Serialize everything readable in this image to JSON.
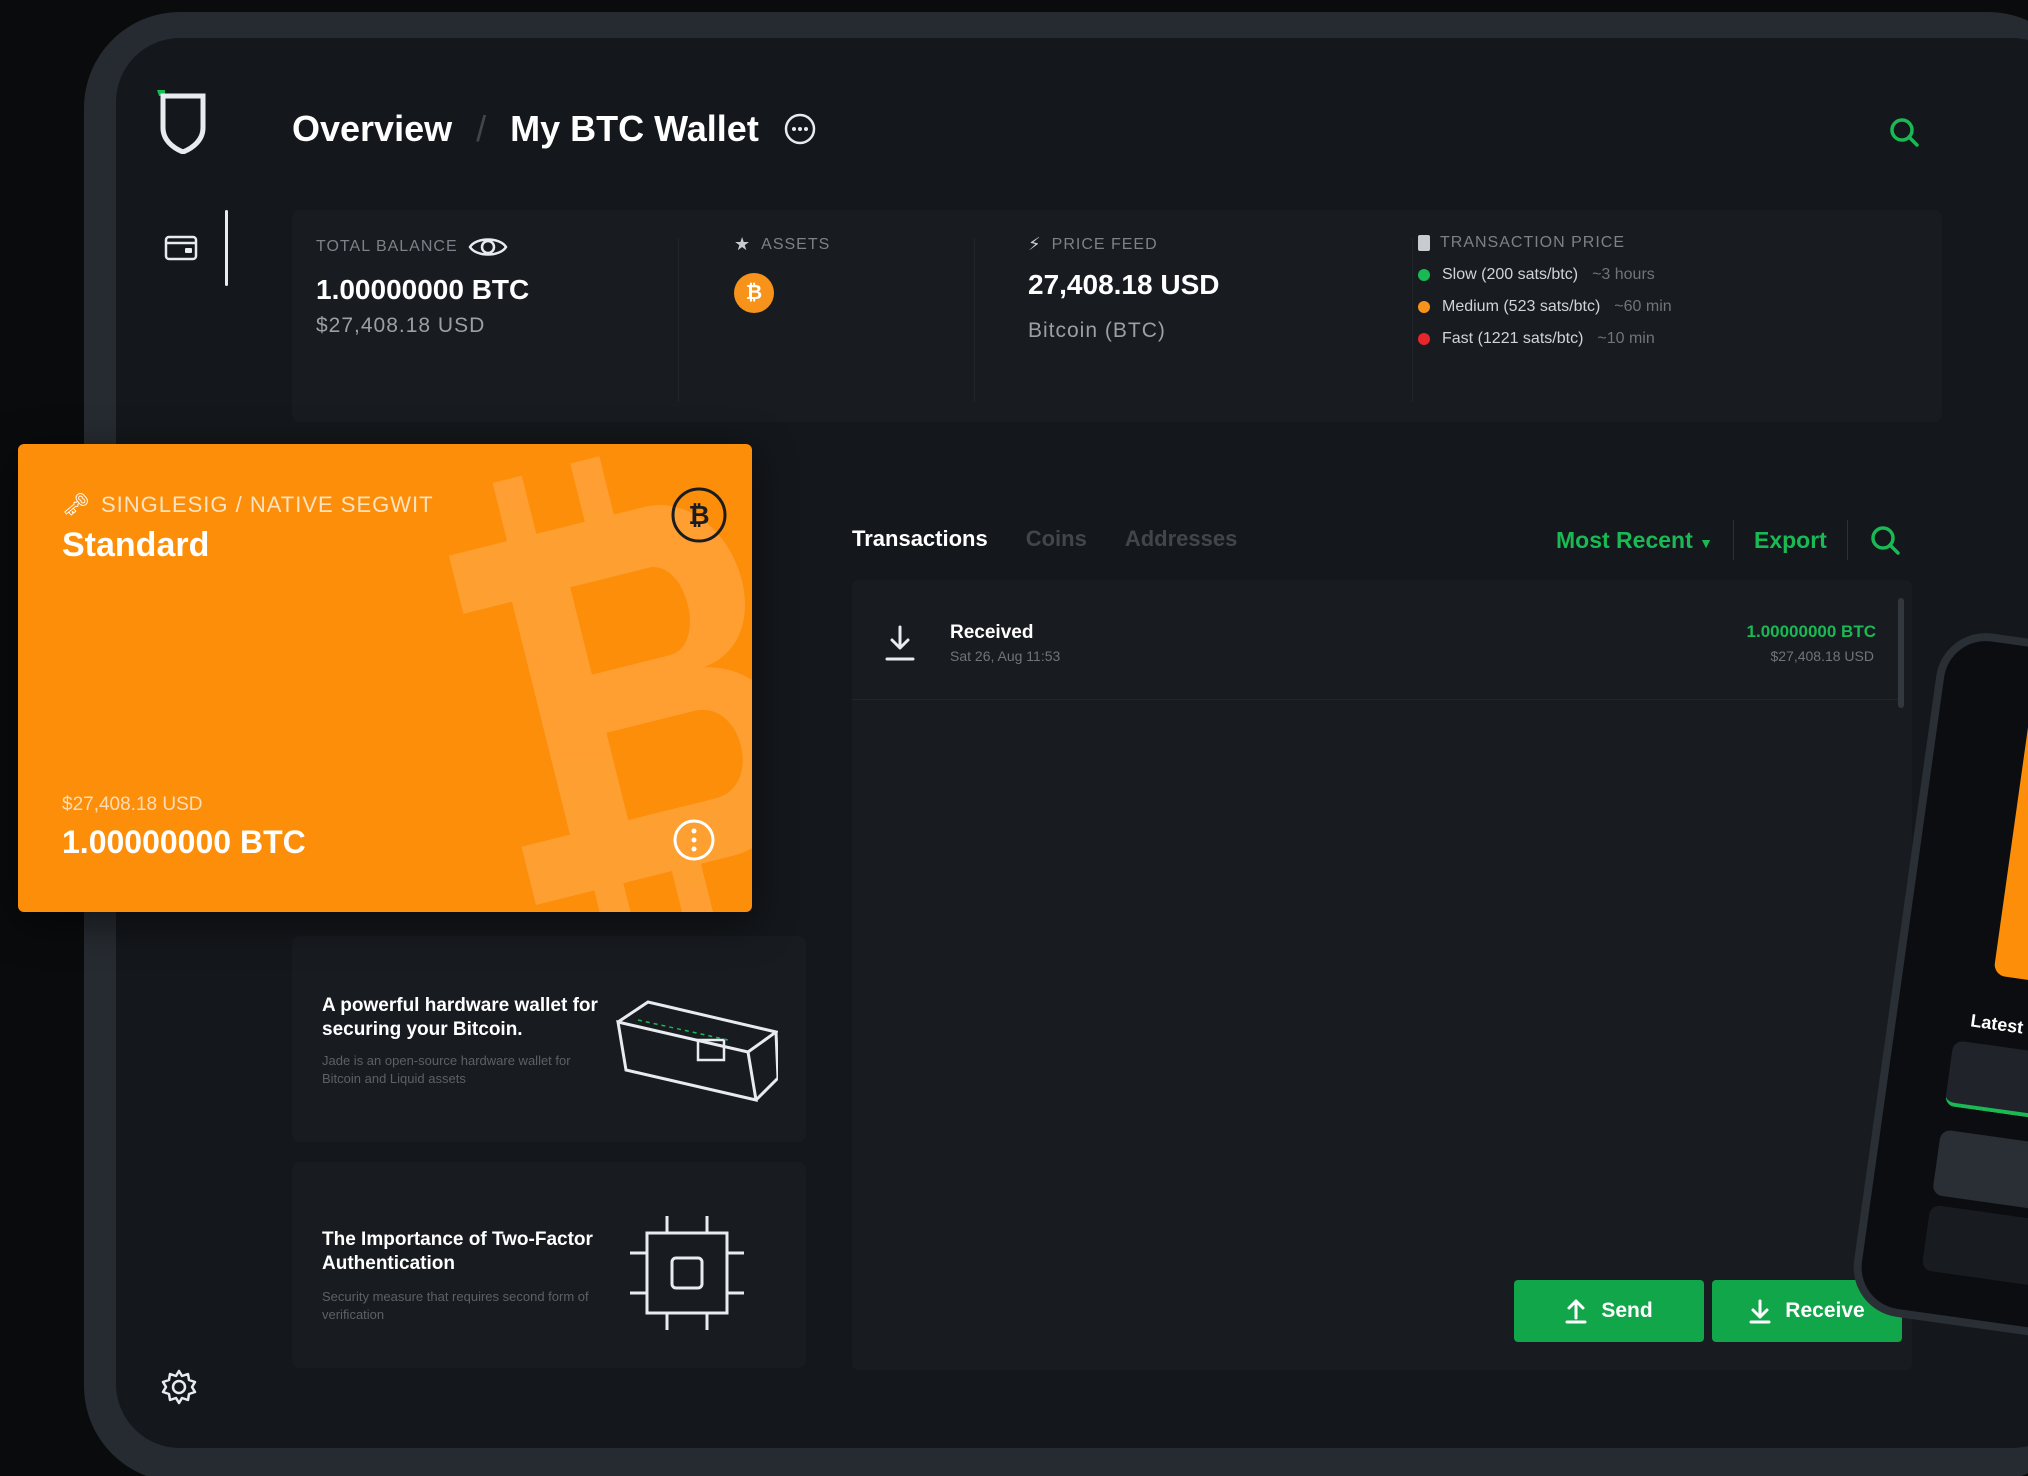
{
  "header": {
    "crumb_root": "Overview",
    "separator": "/",
    "crumb_current": "My BTC Wallet"
  },
  "overview": {
    "balance_label": "TOTAL BALANCE",
    "balance_btc": "1.00000000 BTC",
    "balance_usd": "$27,408.18 USD",
    "assets_label": "ASSETS",
    "asset_symbol": "₿",
    "price_label": "PRICE FEED",
    "price_value": "27,408.18 USD",
    "price_asset": "Bitcoin (BTC)",
    "fee_label": "TRANSACTION PRICE",
    "fees": [
      {
        "label": "Slow (200 sats/btc)",
        "time": "~3 hours",
        "color": "#19b954"
      },
      {
        "label": "Medium (523 sats/btc)",
        "time": "~60 min",
        "color": "#f7931a"
      },
      {
        "label": "Fast (1221 sats/btc)",
        "time": "~10 min",
        "color": "#e5262b"
      }
    ]
  },
  "wallet_card": {
    "type": "SINGLESIG / NATIVE SEGWIT",
    "name": "Standard",
    "usd": "$27,408.18 USD",
    "btc": "1.00000000 BTC"
  },
  "promos": [
    {
      "title": "A powerful hardware wallet for securing your Bitcoin.",
      "desc": "Jade is an open-source hardware wallet for Bitcoin and Liquid assets"
    },
    {
      "title": "The Importance of Two-Factor Authentication",
      "desc": "Security measure that requires second form of verification"
    }
  ],
  "tabs": [
    "Transactions",
    "Coins",
    "Addresses"
  ],
  "tools": {
    "sort": "Most Recent",
    "export": "Export"
  },
  "transactions": [
    {
      "type": "Received",
      "date": "Sat 26, Aug 11:53",
      "btc": "1.00000000 BTC",
      "usd": "$27,408.18 USD"
    }
  ],
  "actions": {
    "send": "Send",
    "receive": "Receive"
  },
  "phone": {
    "latest_label": "Latest"
  },
  "colors": {
    "accent_green": "#19b954",
    "bitcoin_orange": "#fc8e0a",
    "background": "#14171b"
  }
}
